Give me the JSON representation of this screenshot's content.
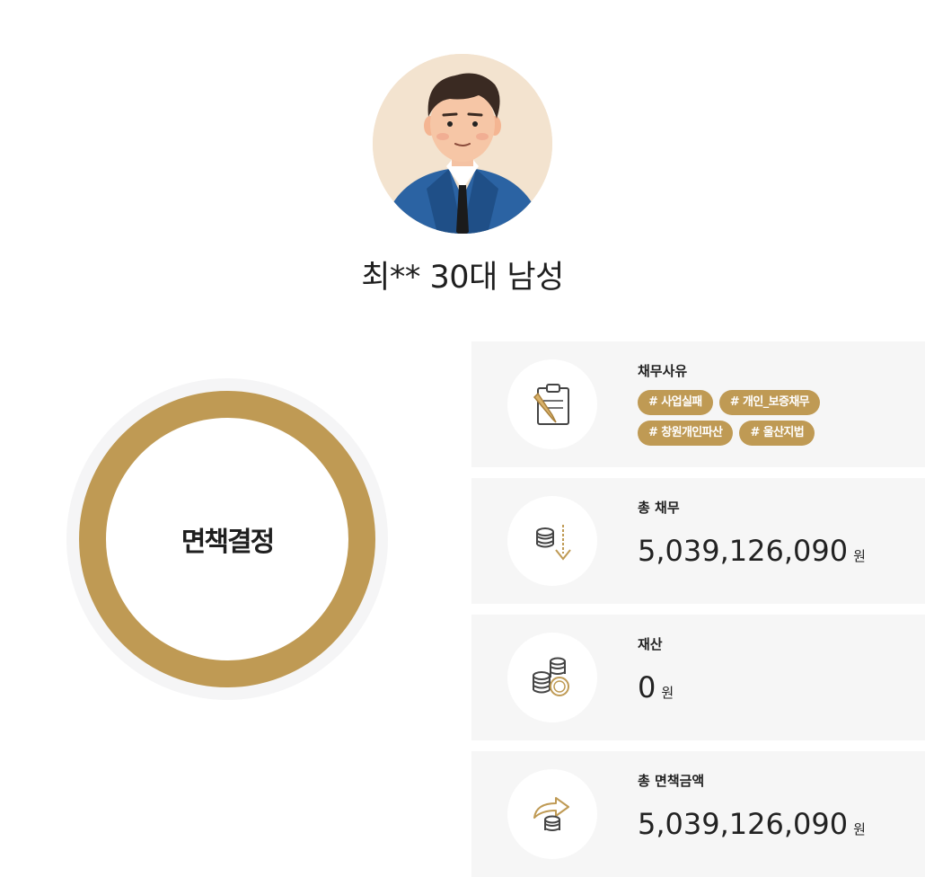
{
  "profile": {
    "avatar_icon": "man-in-suit-avatar",
    "name_line": "최** 30대 남성"
  },
  "status": {
    "label": "면책결정",
    "ring_color": "#bf9a54"
  },
  "cards": {
    "reason": {
      "icon": "clipboard-pencil-icon",
      "title": "채무사유",
      "tags": [
        "# 사업실패",
        "# 개인_보증채무",
        "# 창원개인파산",
        "# 울산지법"
      ]
    },
    "total_debt": {
      "icon": "coins-down-arrow-icon",
      "title": "총 채무",
      "value": "5,039,126,090",
      "unit": "원"
    },
    "assets": {
      "icon": "coin-stacks-icon",
      "title": "재산",
      "value": "0",
      "unit": "원"
    },
    "discharge_total": {
      "icon": "coins-curved-arrow-icon",
      "title": "총 면책금액",
      "value": "5,039,126,090",
      "unit": "원"
    }
  },
  "colors": {
    "accent_gold": "#bf9a54",
    "card_background": "#f6f6f6",
    "text": "#1f1f1f"
  }
}
